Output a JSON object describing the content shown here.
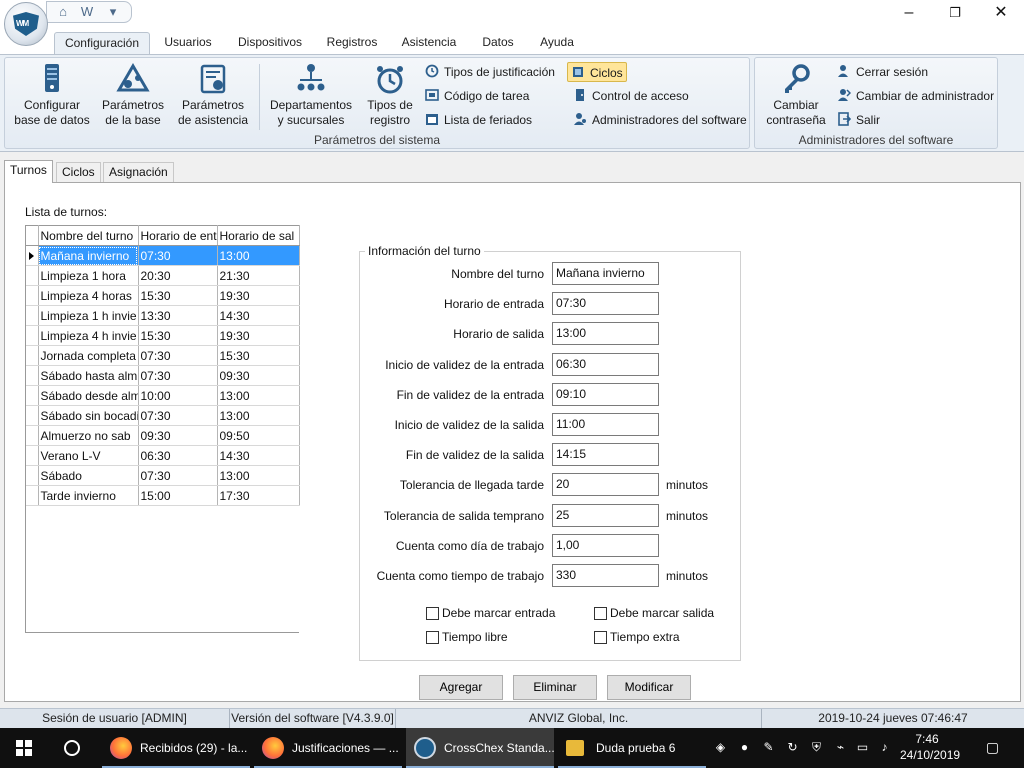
{
  "ribbon": {
    "tabs": [
      "Configuración",
      "Usuarios",
      "Dispositivos",
      "Registros",
      "Asistencia",
      "Datos",
      "Ayuda"
    ],
    "active_tab": "Configuración",
    "group1": {
      "label": "Parámetros del sistema",
      "big_buttons": [
        {
          "line1": "Configurar",
          "line2": "base de datos",
          "icon": "database-server-icon"
        },
        {
          "line1": "Parámetros",
          "line2": "de la base",
          "icon": "base-params-icon"
        },
        {
          "line1": "Parámetros",
          "line2": "de asistencia",
          "icon": "attendance-params-icon"
        },
        {
          "line1": "Departamentos",
          "line2": "y sucursales",
          "icon": "org-chart-icon"
        },
        {
          "line1": "Tipos de",
          "line2": "registro",
          "icon": "alarm-clock-icon"
        }
      ],
      "small_buttons": [
        {
          "label": "Tipos de justificación",
          "icon": "clock-arrows-icon"
        },
        {
          "label": "Código de tarea",
          "icon": "task-code-icon"
        },
        {
          "label": "Lista de feriados",
          "icon": "holiday-list-icon"
        },
        {
          "label": "Ciclos",
          "icon": "cycles-icon"
        },
        {
          "label": "Control de acceso",
          "icon": "access-control-icon"
        },
        {
          "label": "Administradores del software",
          "icon": "admin-users-icon"
        }
      ]
    },
    "group2": {
      "label": "Administradores del software",
      "big_button": {
        "line1": "Cambiar",
        "line2": "contraseña",
        "icon": "key-icon"
      },
      "small_buttons": [
        {
          "label": "Cerrar sesión",
          "icon": "logout-user-icon"
        },
        {
          "label": "Cambiar de administrador",
          "icon": "switch-admin-icon"
        },
        {
          "label": "Salir",
          "icon": "exit-icon"
        }
      ]
    }
  },
  "content": {
    "tabs": [
      "Turnos",
      "Ciclos",
      "Asignación"
    ],
    "active_tab": "Turnos",
    "list_label": "Lista de turnos:",
    "grid": {
      "headers": [
        "Nombre del turno",
        "Horario de ent",
        "Horario de sal"
      ],
      "rows": [
        [
          "Mañana invierno",
          "07:30",
          "13:00"
        ],
        [
          "Limpieza 1 hora",
          "20:30",
          "21:30"
        ],
        [
          "Limpieza 4 horas",
          "15:30",
          "19:30"
        ],
        [
          "Limpieza 1 h invie",
          "13:30",
          "14:30"
        ],
        [
          "Limpieza 4 h invie",
          "15:30",
          "19:30"
        ],
        [
          "Jornada completa",
          "07:30",
          "15:30"
        ],
        [
          "Sábado hasta almu",
          "07:30",
          "09:30"
        ],
        [
          "Sábado desde alm",
          "10:00",
          "13:00"
        ],
        [
          "Sábado sin bocadi",
          "07:30",
          "13:00"
        ],
        [
          "Almuerzo no sab",
          "09:30",
          "09:50"
        ],
        [
          "Verano L-V",
          "06:30",
          "14:30"
        ],
        [
          "Sábado",
          "07:30",
          "13:00"
        ],
        [
          "Tarde invierno",
          "15:00",
          "17:30"
        ]
      ]
    },
    "info": {
      "legend": "Información del turno",
      "fields": [
        {
          "label": "Nombre del turno",
          "value": "Mañana invierno",
          "suffix": ""
        },
        {
          "label": "Horario de entrada",
          "value": "07:30",
          "suffix": ""
        },
        {
          "label": "Horario de salida",
          "value": "13:00",
          "suffix": ""
        },
        {
          "label": "Inicio de validez de la entrada",
          "value": "06:30",
          "suffix": ""
        },
        {
          "label": "Fin de validez de la entrada",
          "value": "09:10",
          "suffix": ""
        },
        {
          "label": "Inicio de validez de la salida",
          "value": "11:00",
          "suffix": ""
        },
        {
          "label": "Fin de validez de la salida",
          "value": "14:15",
          "suffix": ""
        },
        {
          "label": "Tolerancia de llegada tarde",
          "value": "20",
          "suffix": "minutos"
        },
        {
          "label": "Tolerancia de salida temprano",
          "value": "25",
          "suffix": "minutos"
        },
        {
          "label": "Cuenta como día de trabajo",
          "value": "1,00",
          "suffix": ""
        },
        {
          "label": "Cuenta como tiempo de trabajo",
          "value": "330",
          "suffix": "minutos"
        }
      ],
      "checkboxes": [
        {
          "label": "Debe marcar entrada",
          "checked": false
        },
        {
          "label": "Debe marcar salida",
          "checked": false
        },
        {
          "label": "Tiempo libre",
          "checked": false
        },
        {
          "label": "Tiempo extra",
          "checked": false
        }
      ]
    },
    "buttons": {
      "add": "Agregar",
      "delete": "Eliminar",
      "modify": "Modificar"
    }
  },
  "statusbar": {
    "session": "Sesión de usuario  [ADMIN]",
    "version": "Versión del software  [V4.3.9.0]",
    "company": "ANVIZ Global, Inc.",
    "datetime": "2019-10-24 jueves 07:46:47"
  },
  "taskbar": {
    "apps": [
      {
        "label": "Recibidos (29) - la...",
        "icon": "firefox-icon",
        "active": false
      },
      {
        "label": "Justificaciones — ...",
        "icon": "firefox-icon",
        "active": false
      },
      {
        "label": "CrossChex Standa...",
        "icon": "crosschex-icon",
        "active": true
      },
      {
        "label": "Duda prueba 6",
        "icon": "folder-icon",
        "active": false
      }
    ],
    "time": "7:46",
    "date": "24/10/2019"
  },
  "colors": {
    "selection": "#3399ff",
    "ribbon_bg": "#eaf0f6",
    "highlight": "#ffe59a"
  }
}
